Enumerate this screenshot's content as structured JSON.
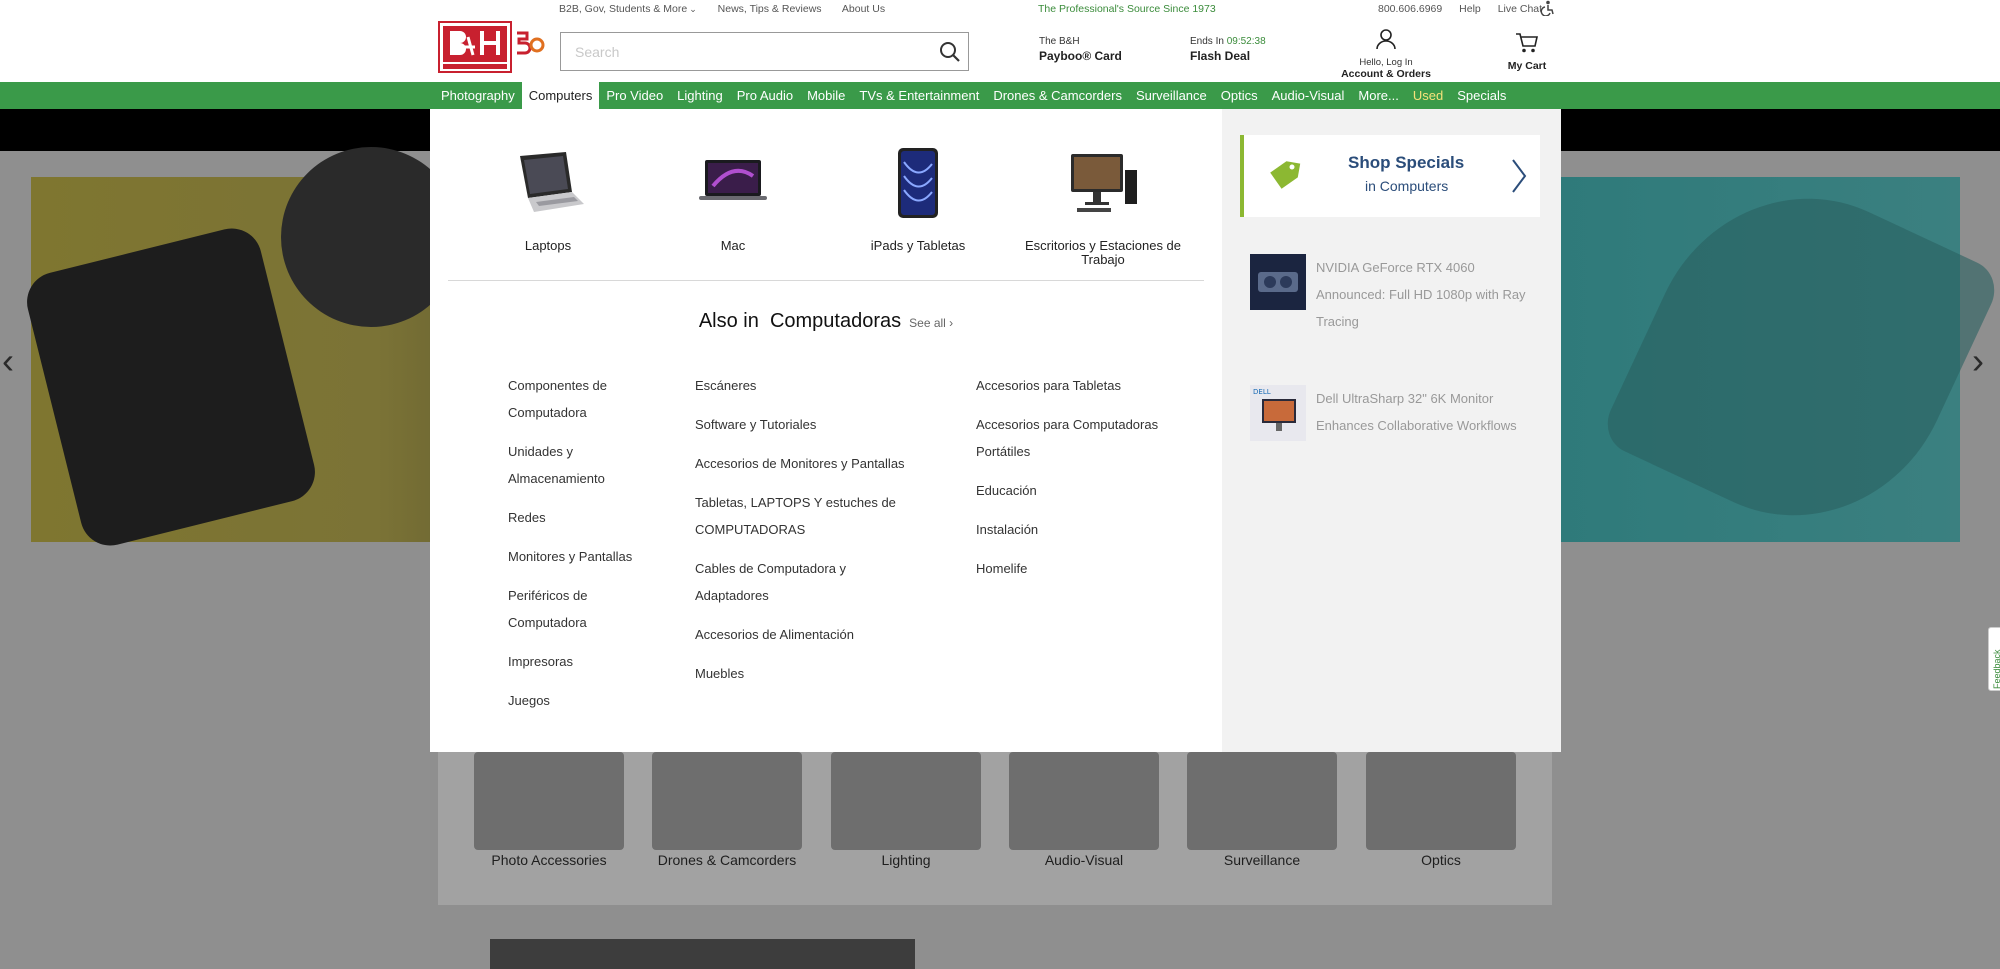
{
  "utility": {
    "links_left": [
      "B2B, Gov, Students & More",
      "News, Tips & Reviews",
      "About Us"
    ],
    "tagline": "The Professional's Source Since 1973",
    "phone": "800.606.6969",
    "help": "Help",
    "live_chat": "Live Chat"
  },
  "search": {
    "placeholder": "Search"
  },
  "payboo": {
    "line1": "The B&H",
    "line2": "Payboo® Card"
  },
  "flash": {
    "prefix": "Ends In",
    "timer": "09:52:38",
    "label": "Flash Deal"
  },
  "account": {
    "line1": "Hello, Log In",
    "line2": "Account & Orders"
  },
  "cart": {
    "label": "My Cart"
  },
  "nav": [
    "Photography",
    "Computers",
    "Pro Video",
    "Lighting",
    "Pro Audio",
    "Mobile",
    "TVs & Entertainment",
    "Drones & Camcorders",
    "Surveillance",
    "Optics",
    "Audio-Visual",
    "More...",
    "Used",
    "Specials"
  ],
  "mega": {
    "products": [
      "Laptops",
      "Mac",
      "iPads y Tabletas",
      "Escritorios y Estaciones de Trabajo"
    ],
    "also_title": "Also in  Computadoras",
    "see_all": "See all",
    "col1": [
      "Componentes de Computadora",
      "Unidades y Almacenamiento",
      "Redes",
      "Monitores y Pantallas",
      "Periféricos de Computadora",
      "Impresoras",
      "Juegos"
    ],
    "col2": [
      "Escáneres",
      "Software y Tutoriales",
      "Accesorios de Monitores y Pantallas",
      "Tabletas, LAPTOPS Y estuches de COMPUTADORAS",
      "Cables de Computadora y Adaptadores",
      "Accesorios de Alimentación",
      "Muebles"
    ],
    "col3": [
      "Accesorios para Tabletas",
      "Accesorios para Computadoras Portátiles",
      "Educación",
      "Instalación",
      "Homelife"
    ],
    "specials": {
      "title": "Shop Specials",
      "subtitle": "in Computers"
    },
    "news": [
      "NVIDIA GeForce RTX 4060 Announced: Full HD 1080p with Ray Tracing",
      "Dell UltraSharp 32\" 6K Monitor Enhances Collaborative Workflows"
    ]
  },
  "categories": [
    "Photo Accessories",
    "Drones & Camcorders",
    "Lighting",
    "Audio-Visual",
    "Surveillance",
    "Optics"
  ],
  "feedback": "Feedback",
  "colors": {
    "brand_green": "#3a9a49",
    "accent_lime": "#8cb832",
    "specials_blue": "#2b4d7a"
  }
}
